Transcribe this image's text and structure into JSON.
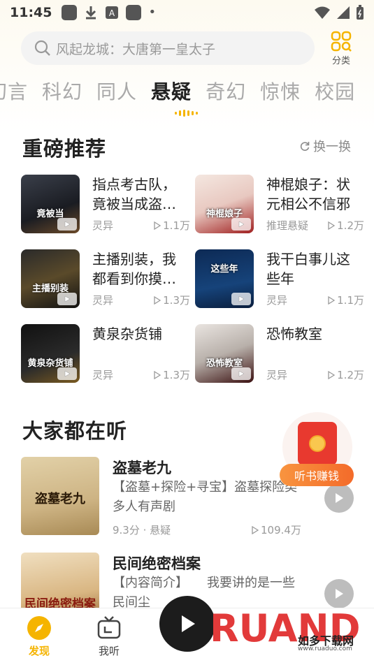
{
  "status_bar": {
    "time": "11:45"
  },
  "search": {
    "placeholder": "风起龙城：大唐第一皇太子"
  },
  "category": {
    "label": "分类"
  },
  "genre_tabs": [
    "幻言",
    "科幻",
    "同人",
    "悬疑",
    "奇幻",
    "惊悚",
    "校园"
  ],
  "active_tab": "悬疑",
  "featured": {
    "title": "重磅推荐",
    "refresh_label": "换一换",
    "books": [
      {
        "title": "指点考古队，竟被当成盗…",
        "genre": "灵异",
        "plays": "1.1万",
        "cover_text": "竟被当"
      },
      {
        "title": "神棍娘子：状元相公不信邪",
        "genre": "推理悬疑",
        "plays": "1.2万",
        "cover_text": "神棍娘子"
      },
      {
        "title": "主播别装，我都看到你摸…",
        "genre": "灵异",
        "plays": "1.3万",
        "cover_text": "主播别装"
      },
      {
        "title": "我干白事儿这些年",
        "genre": "灵异",
        "plays": "1.1万",
        "cover_text": "这些年"
      },
      {
        "title": "黄泉杂货铺",
        "genre": "灵异",
        "plays": "1.3万",
        "cover_text": "黄泉杂货铺"
      },
      {
        "title": "恐怖教室",
        "genre": "灵异",
        "plays": "1.2万",
        "cover_text": "恐怖教室"
      }
    ]
  },
  "listening": {
    "title": "大家都在听",
    "items": [
      {
        "title": "盗墓老九",
        "desc": "【盗墓+探险+寻宝】盗墓探险类多人有声剧",
        "meta": "9.3分 · 悬疑",
        "plays": "109.4万",
        "cover_text": "盗墓老九"
      },
      {
        "title": "民间绝密档案",
        "desc": "【内容简介】　　我要讲的是一些民间尘",
        "meta": "",
        "plays": "",
        "cover_text": "民间绝密档案"
      }
    ]
  },
  "reward": {
    "label": "听书赚钱"
  },
  "nav": {
    "discover": "发现",
    "mine": "我听"
  },
  "watermark": {
    "brand": "RUANDO",
    "sub": "如多下载网",
    "url": "www.ruaduo.com"
  }
}
